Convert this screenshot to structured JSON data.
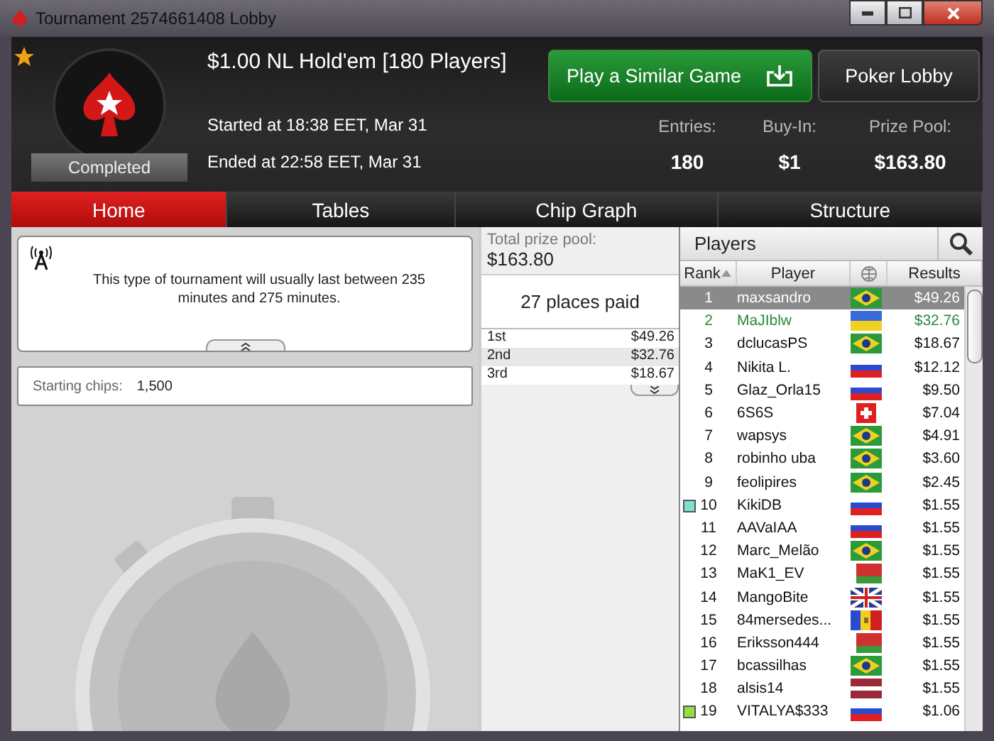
{
  "window": {
    "title": "Tournament 2574661408 Lobby"
  },
  "header": {
    "favorite": true,
    "status": "Completed",
    "game": "$1.00 NL Hold'em [180 Players]",
    "started": "Started at 18:38 EET, Mar 31",
    "ended": "Ended at 22:58 EET, Mar 31",
    "stats": [
      {
        "label": "Entries:",
        "value": "180"
      },
      {
        "label": "Buy-In:",
        "value": "$1"
      },
      {
        "label": "Prize Pool:",
        "value": "$163.80"
      }
    ],
    "buttons": [
      {
        "label": "Play a Similar Game",
        "kind": "primary"
      },
      {
        "label": "Poker Lobby",
        "kind": "secondary"
      }
    ]
  },
  "tabs": [
    {
      "label": "Home",
      "selected": true
    },
    {
      "label": "Tables",
      "selected": false
    },
    {
      "label": "Chip Graph",
      "selected": false
    },
    {
      "label": "Structure",
      "selected": false
    }
  ],
  "info": {
    "message": "This type of tournament will usually last between 235 minutes and 275 minutes.",
    "starting_chips_label": "Starting chips:",
    "starting_chips": "1,500"
  },
  "prizes": {
    "total_label": "Total prize pool:",
    "total": "$163.80",
    "places_paid": "27 places paid",
    "rows": [
      {
        "place": "1st",
        "amount": "$49.26"
      },
      {
        "place": "2nd",
        "amount": "$32.76"
      },
      {
        "place": "3rd",
        "amount": "$18.67"
      }
    ]
  },
  "players": {
    "title": "Players",
    "columns": [
      "Rank",
      "Player",
      "Results"
    ],
    "rows": [
      {
        "rank": "1",
        "player": "maxsandro",
        "kind": "br",
        "result": "$49.26",
        "selected": true,
        "highlighted": false
      },
      {
        "rank": "2",
        "player": "MaJIblw",
        "kind": "ua",
        "result": "$32.76",
        "selected": false,
        "highlighted": true
      },
      {
        "rank": "3",
        "player": "dclucasPS",
        "kind": "br",
        "result": "$18.67",
        "selected": false,
        "highlighted": false
      },
      {
        "rank": "4",
        "player": "Nikita L.",
        "kind": "ru",
        "result": "$12.12",
        "selected": false,
        "highlighted": false
      },
      {
        "rank": "5",
        "player": "Glaz_Orla15",
        "kind": "ru",
        "result": "$9.50",
        "selected": false,
        "highlighted": false
      },
      {
        "rank": "6",
        "player": "6S6S",
        "kind": "ch",
        "result": "$7.04",
        "selected": false,
        "highlighted": false
      },
      {
        "rank": "7",
        "player": "wapsys",
        "kind": "br",
        "result": "$4.91",
        "selected": false,
        "highlighted": false
      },
      {
        "rank": "8",
        "player": "robinho uba",
        "kind": "br",
        "result": "$3.60",
        "selected": false,
        "highlighted": false
      },
      {
        "rank": "9",
        "player": "feolipires",
        "kind": "br",
        "result": "$2.45",
        "selected": false,
        "highlighted": false
      },
      {
        "rank": "10",
        "player": "KikiDB",
        "kind": "ru",
        "result": "$1.55",
        "selected": false,
        "highlighted": false,
        "color": "#7fe0d0"
      },
      {
        "rank": "11",
        "player": "AAVaIAA",
        "kind": "ru",
        "result": "$1.55",
        "selected": false,
        "highlighted": false
      },
      {
        "rank": "12",
        "player": "Marc_Melão",
        "kind": "br",
        "result": "$1.55",
        "selected": false,
        "highlighted": false
      },
      {
        "rank": "13",
        "player": "MaK1_EV",
        "kind": "by",
        "result": "$1.55",
        "selected": false,
        "highlighted": false
      },
      {
        "rank": "14",
        "player": "MangoBite",
        "kind": "gb",
        "result": "$1.55",
        "selected": false,
        "highlighted": false
      },
      {
        "rank": "15",
        "player": "84mersedes...",
        "kind": "md",
        "result": "$1.55",
        "selected": false,
        "highlighted": false
      },
      {
        "rank": "16",
        "player": "Eriksson444",
        "kind": "by",
        "result": "$1.55",
        "selected": false,
        "highlighted": false
      },
      {
        "rank": "17",
        "player": "bcassilhas",
        "kind": "br",
        "result": "$1.55",
        "selected": false,
        "highlighted": false
      },
      {
        "rank": "18",
        "player": "alsis14",
        "kind": "lv",
        "result": "$1.55",
        "selected": false,
        "highlighted": false
      },
      {
        "rank": "19",
        "player": "VITALYA$333",
        "kind": "ru",
        "result": "$1.06",
        "selected": false,
        "highlighted": false,
        "color": "#90e040"
      }
    ]
  }
}
